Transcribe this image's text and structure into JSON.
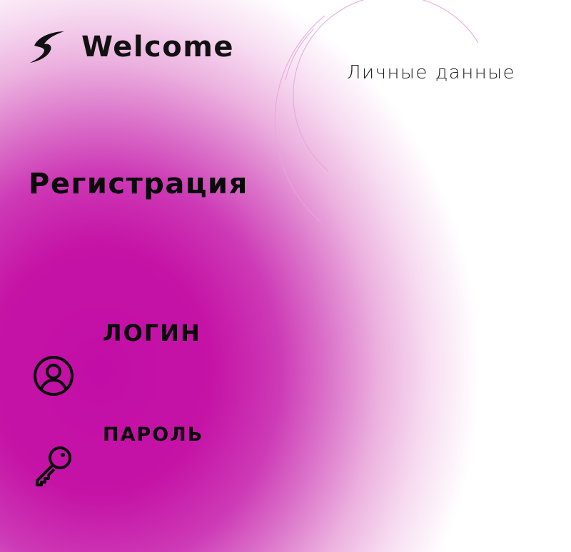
{
  "header": {
    "brand_title": "Welcome",
    "logo_icon": "swoosh-logo-icon",
    "nav_link": "Личные данные"
  },
  "form": {
    "title": "Регистрация",
    "login": {
      "label": "ЛОГИН",
      "icon": "user-icon",
      "value": ""
    },
    "password": {
      "label": "ПАРОЛЬ",
      "icon": "key-icon",
      "value": ""
    }
  },
  "colors": {
    "accent": "#c20ea6",
    "text": "#0a0a0a",
    "background": "#ffffff"
  }
}
